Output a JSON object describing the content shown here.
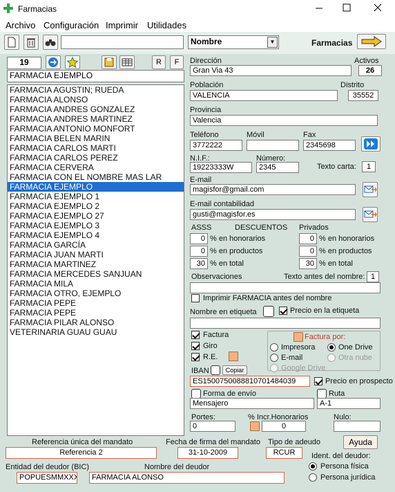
{
  "window": {
    "title": "Farmacias",
    "minimize": "—",
    "maximize": "☐",
    "close": "✕"
  },
  "menu": {
    "items": [
      "Archivo",
      "Configuración",
      "Imprimir",
      "Utilidades"
    ]
  },
  "toolbar": {
    "search_value": "",
    "sort_field": "Nombre",
    "section_label": "Farmacias"
  },
  "nav": {
    "record_number": "19",
    "r_label": "R",
    "f_label": "F",
    "current_name": "FARMACIA EJEMPLO"
  },
  "list": {
    "items": [
      "FARMACIA AGUSTIN; RUEDA",
      "FARMACIA ALONSO",
      "FARMACIA ANDRES GONZALEZ",
      "FARMACIA ANDRES MARTINEZ",
      "FARMACIA ANTONIO MONFORT",
      "FARMACIA BELEN MARIN",
      "FARMACIA CARLOS MARTI",
      "FARMACIA CARLOS PEREZ",
      "FARMACIA CERVERA",
      "FARMACIA CON EL NOMBRE MAS LAR",
      "FARMACIA EJEMPLO",
      "FARMACIA EJEMPLO 1",
      "FARMACIA EJEMPLO 2",
      "FARMACIA EJEMPLO 27",
      "FARMACIA EJEMPLO 3",
      "FARMACIA EJEMPLO 4",
      "FARMACIA GARCÍA",
      "FARMACIA JUAN MARTI",
      "FARMACIA MARTINEZ",
      "FARMACIA MERCEDES SANJUAN",
      "FARMACIA MILA",
      "FARMACIA OTRO, EJEMPLO",
      "FARMACIA PEPE",
      "FARMACIA PEPE",
      "FARMACIA PILAR ALONSO",
      "VETERINARIA GUAU GUAU"
    ],
    "selected_index": 10
  },
  "form": {
    "direccion_label": "Dirección",
    "direccion": "Gran Via 43",
    "activos_label": "Activos",
    "activos": "26",
    "poblacion_label": "Población",
    "poblacion": "VALENCIA",
    "distrito_label": "Distrito",
    "distrito": "35552",
    "provincia_label": "Provincia",
    "provincia": "Valencia",
    "telefono_label": "Teléfono",
    "telefono": "3772222",
    "movil_label": "Móvil",
    "movil": "",
    "fax_label": "Fax",
    "fax": "2345698",
    "nif_label": "N.I.F.:",
    "nif": "19223333W",
    "numero_label": "Número:",
    "numero": "2345",
    "texto_carta_label": "Texto carta:",
    "texto_carta": "1",
    "email_label": "E-mail",
    "email": "magisfor@gmail.com",
    "email_cont_label": "E-mail contabilidad",
    "email_cont": "gusti@magisfor.es",
    "asss_label": "ASSS",
    "descuentos_label": "DESCUENTOS",
    "privados_label": "Privados",
    "hon_label": "% en honorarios",
    "prod_label": "% en productos",
    "total_label": "% en total",
    "asss_hon": "0",
    "asss_prod": "0",
    "asss_total": "30",
    "priv_hon": "0",
    "priv_prod": "0",
    "priv_total": "30",
    "observaciones_label": "Observaciones",
    "texto_antes_label": "Texto antes del nombre:",
    "texto_antes": "1",
    "observaciones": "",
    "imprimir_farmacia_label": "Imprimir FARMACIA antes del nombre",
    "nombre_etiqueta_label": "Nombre en etiqueta",
    "precio_etiqueta_label": "Precio en la etiqueta",
    "nombre_etiqueta": "",
    "factura_label": "Factura",
    "giro_label": "Giro",
    "re_label": "R.E.",
    "factura_por_label": "Factura por:",
    "impresora_label": "Impresora",
    "one_drive_label": "One Drive",
    "email_opt_label": "E-mail",
    "otra_nube_label": "Otra nube",
    "google_drive_label": "Google Drive",
    "iban_label": "IBAN",
    "copiar_label": "Copiar",
    "iban": "ES1500750088810701484039",
    "precio_prospecto_label": "Precio en prospecto",
    "forma_envio_label": "Forma de envío",
    "forma_envio": "Mensajero",
    "ruta_label": "Ruta",
    "ruta": "A-1",
    "portes_label": "Portes:",
    "portes": "0",
    "incr_label": "% Incr.Honorarios",
    "incr": "0",
    "nulo_label": "Nulo:",
    "nulo": ""
  },
  "mandate": {
    "ref_label": "Referencia única del mandato",
    "ref": "Referencia 2",
    "fecha_label": "Fecha de firma del mandato",
    "fecha": "31-10-2009",
    "tipo_label": "Tipo de adeudo",
    "tipo": "RCUR",
    "ayuda_label": "Ayuda",
    "bic_label": "Entidad del deudor (BIC)",
    "bic": "POPUESMMXXX",
    "nombre_label": "Nombre del deudor",
    "nombre": "FARMACIA ALONSO",
    "ident_label": "Ident. del deudor:",
    "fisica_label": "Persona física",
    "juridica_label": "Persona jurídica"
  },
  "colors": {
    "selection": "#1f6fd1",
    "panel": "#d4e2db",
    "accent_orange": "#f3b080",
    "title_icon": "#2fa84f"
  }
}
